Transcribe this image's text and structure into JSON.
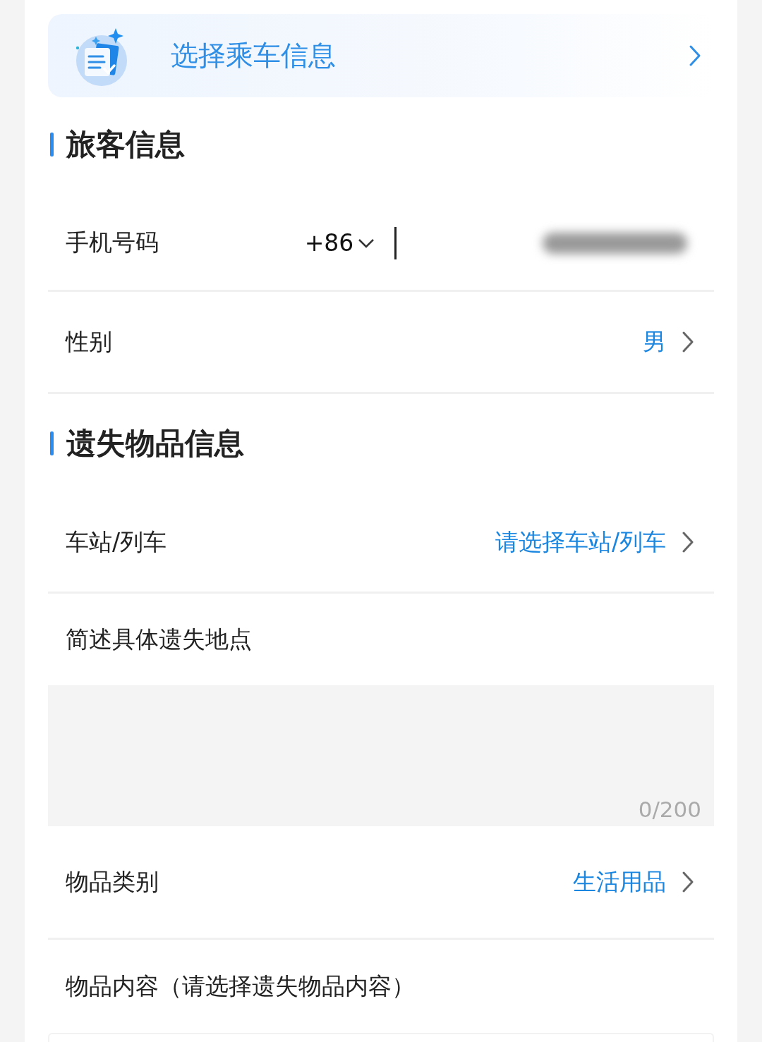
{
  "banner": {
    "title": "选择乘车信息"
  },
  "sections": [
    {
      "title": "旅客信息",
      "fields": [
        {
          "kind": "phone",
          "label": "手机号码",
          "country_code": "+86"
        },
        {
          "kind": "select",
          "label": "性别",
          "value": "男"
        }
      ]
    },
    {
      "title": "遗失物品信息",
      "fields": [
        {
          "kind": "select",
          "label": "车站/列车",
          "value": "请选择车站/列车"
        },
        {
          "kind": "textarea",
          "label": "简述具体遗失地点",
          "counter": "0/200"
        },
        {
          "kind": "select",
          "label": "物品类别",
          "value": "生活用品"
        },
        {
          "kind": "box",
          "label": "物品内容（请选择遗失物品内容）"
        }
      ]
    }
  ]
}
